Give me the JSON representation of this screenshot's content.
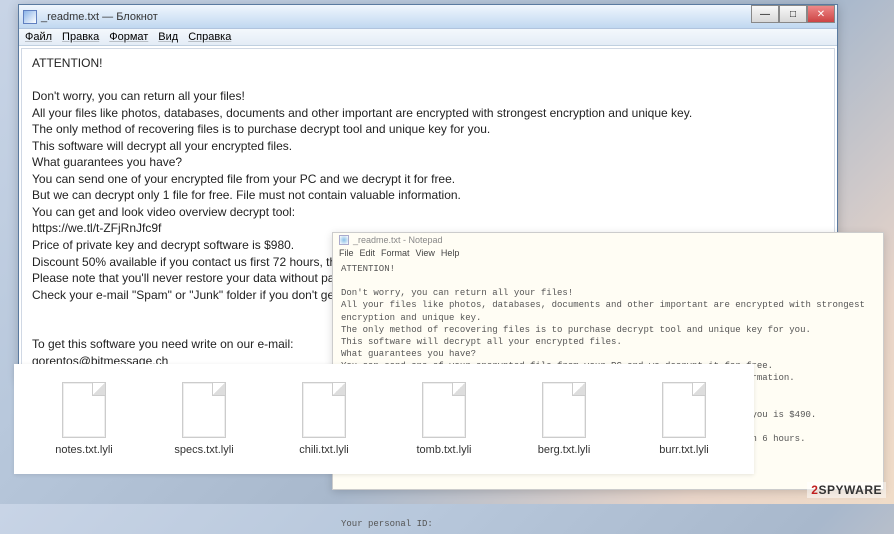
{
  "window_back": {
    "title": "_readme.txt — Блокнот",
    "menu": [
      "Файл",
      "Правка",
      "Формат",
      "Вид",
      "Справка"
    ],
    "content": "ATTENTION!\n\nDon't worry, you can return all your files!\nAll your files like photos, databases, documents and other important are encrypted with strongest encryption and unique key.\nThe only method of recovering files is to purchase decrypt tool and unique key for you.\nThis software will decrypt all your encrypted files.\nWhat guarantees you have?\nYou can send one of your encrypted file from your PC and we decrypt it for free.\nBut we can decrypt only 1 file for free. File must not contain valuable information.\nYou can get and look video overview decrypt tool:\nhttps://we.tl/t-ZFjRnJfc9f\nPrice of private key and decrypt software is $980.\nDiscount 50% available if you contact us first 72 hours, that's price for you is $490.\nPlease note that you'll never restore your data without pa\nCheck your e-mail \"Spam\" or \"Junk\" folder if you don't ge\n\n\nTo get this software you need write on our e-mail:\ngorentos@bitmessage.ch\n\nReserve e-mail address to contact us:\ngorentoshelp@firemail.cc"
  },
  "window_front": {
    "title": "_readme.txt - Notepad",
    "menu": [
      "File",
      "Edit",
      "Format",
      "View",
      "Help"
    ],
    "content": "ATTENTION!\n\nDon't worry, you can return all your files!\nAll your files like photos, databases, documents and other important are encrypted with strongest encryption and unique key.\nThe only method of recovering files is to purchase decrypt tool and unique key for you.\nThis software will decrypt all your encrypted files.\nWhat guarantees you have?\nYou can send one of your encrypted file from your PC and we decrypt it for free.\nBut we can decrypt only 1 file for free. File must not contain valuable information.\nYou can get and look video overview decrypt tool:\n                                               $980.\n                                               t 72 hours, that's price for you is $490.\n                                               ta without payment.\n                                               you don't get answer more than 6 hours.\n\n                                               -mail:\n\n\n\n\nYour personal ID:"
  },
  "files": [
    {
      "name": "notes.txt.lyli"
    },
    {
      "name": "specs.txt.lyli"
    },
    {
      "name": "chili.txt.lyli"
    },
    {
      "name": "tomb.txt.lyli"
    },
    {
      "name": "berg.txt.lyli"
    },
    {
      "name": "burr.txt.lyli"
    }
  ],
  "watermark": {
    "prefix": "2",
    "suffix": "SPYWARE"
  },
  "winbtns": {
    "min": "—",
    "max": "□",
    "close": "✕"
  }
}
